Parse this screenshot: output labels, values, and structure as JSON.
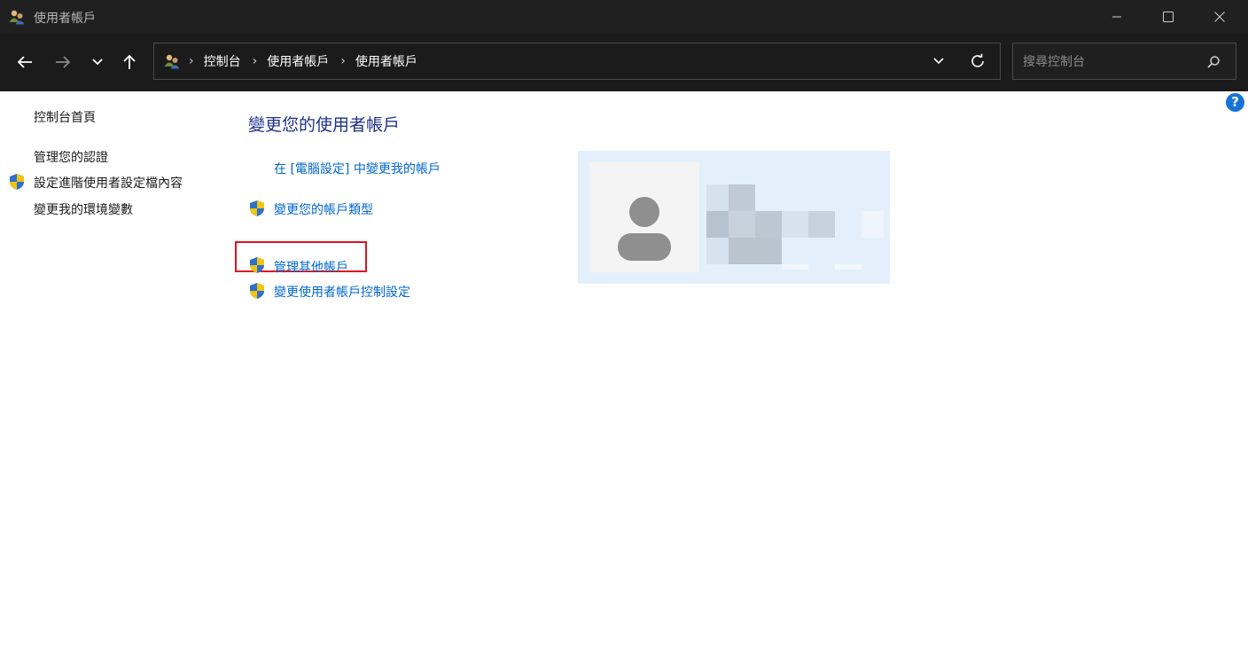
{
  "window": {
    "title": "使用者帳戶",
    "minimize_icon": "minimize-icon",
    "maximize_icon": "maximize-icon",
    "close_icon": "close-icon"
  },
  "navigation": {
    "back_icon": "arrow-left-icon",
    "forward_icon": "arrow-right-icon",
    "recent_icon": "chevron-down-icon",
    "up_icon": "arrow-up-icon"
  },
  "address": {
    "breadcrumbs": [
      "控制台",
      "使用者帳戶",
      "使用者帳戶"
    ],
    "separator": "›"
  },
  "search": {
    "placeholder": "搜尋控制台"
  },
  "sidebar": {
    "home": "控制台首頁",
    "items": [
      {
        "label": "管理您的認證",
        "shield": false
      },
      {
        "label": "設定進階使用者設定檔內容",
        "shield": true
      },
      {
        "label": "變更我的環境變數",
        "shield": false
      }
    ]
  },
  "main": {
    "heading": "變更您的使用者帳戶",
    "links": [
      {
        "label": "在 [電腦設定] 中變更我的帳戶",
        "shield": false
      },
      {
        "label": "變更您的帳戶類型",
        "shield": true
      },
      {
        "label": "管理其他帳戶",
        "shield": true,
        "highlighted": true
      },
      {
        "label": "變更使用者帳戶控制設定",
        "shield": true
      }
    ]
  },
  "help": {
    "label": "?"
  },
  "colors": {
    "titlebar_bg": "#202020",
    "navbar_bg": "#1b1b1b",
    "heading": "#1e3287",
    "link": "#0066cc",
    "highlight": "#e0141c",
    "tile_bg": "#e3f0fc"
  }
}
